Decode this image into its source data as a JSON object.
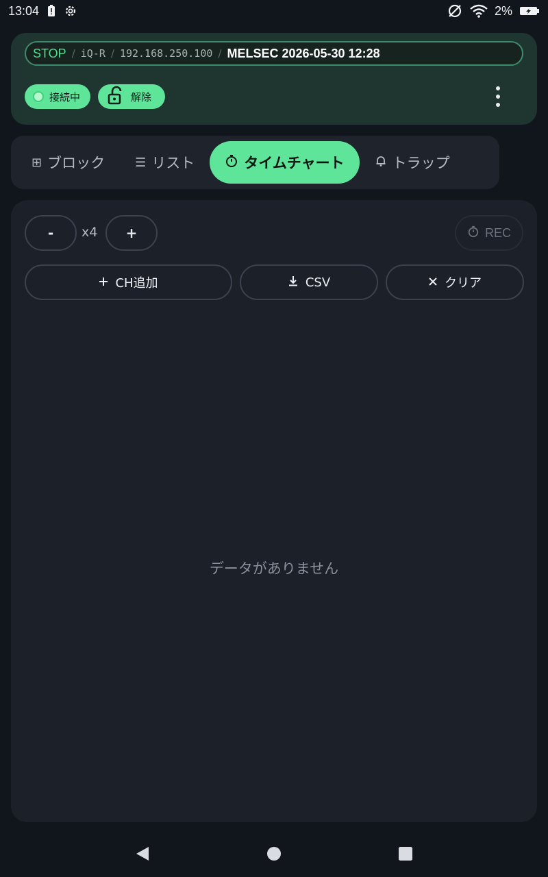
{
  "status_bar": {
    "time": "13:04",
    "battery_percent": "2%",
    "icons": [
      "battery-alert-icon",
      "settings-icon",
      "no-sim-icon",
      "wifi-icon",
      "battery-charging-icon"
    ]
  },
  "header": {
    "plc_state": "STOP",
    "model": "iQ-R",
    "ip_address": "192.168.250.100",
    "title": "MELSEC 2026-05-30 12:28",
    "connection_chip": "接続中",
    "unlock_chip": "解除"
  },
  "tabs": [
    {
      "icon": "⊞",
      "label": "ブロック",
      "active": false
    },
    {
      "icon": "☰",
      "label": "リスト",
      "active": false
    },
    {
      "icon": "⏱",
      "label": "タイムチャート",
      "active": true
    },
    {
      "icon": "🔔",
      "label": "トラップ",
      "active": false
    }
  ],
  "chart_panel": {
    "minus_label": "-",
    "zoom_label": "x4",
    "plus_label": "+",
    "rec_label": "REC",
    "add_channel_label": "CH追加",
    "csv_label": "CSV",
    "clear_label": "クリア",
    "empty_message": "データがありません"
  },
  "colors": {
    "accent": "#5fe59a",
    "header_bg": "#1f3530",
    "panel_bg": "#1c2029",
    "page_bg": "#11151c"
  }
}
